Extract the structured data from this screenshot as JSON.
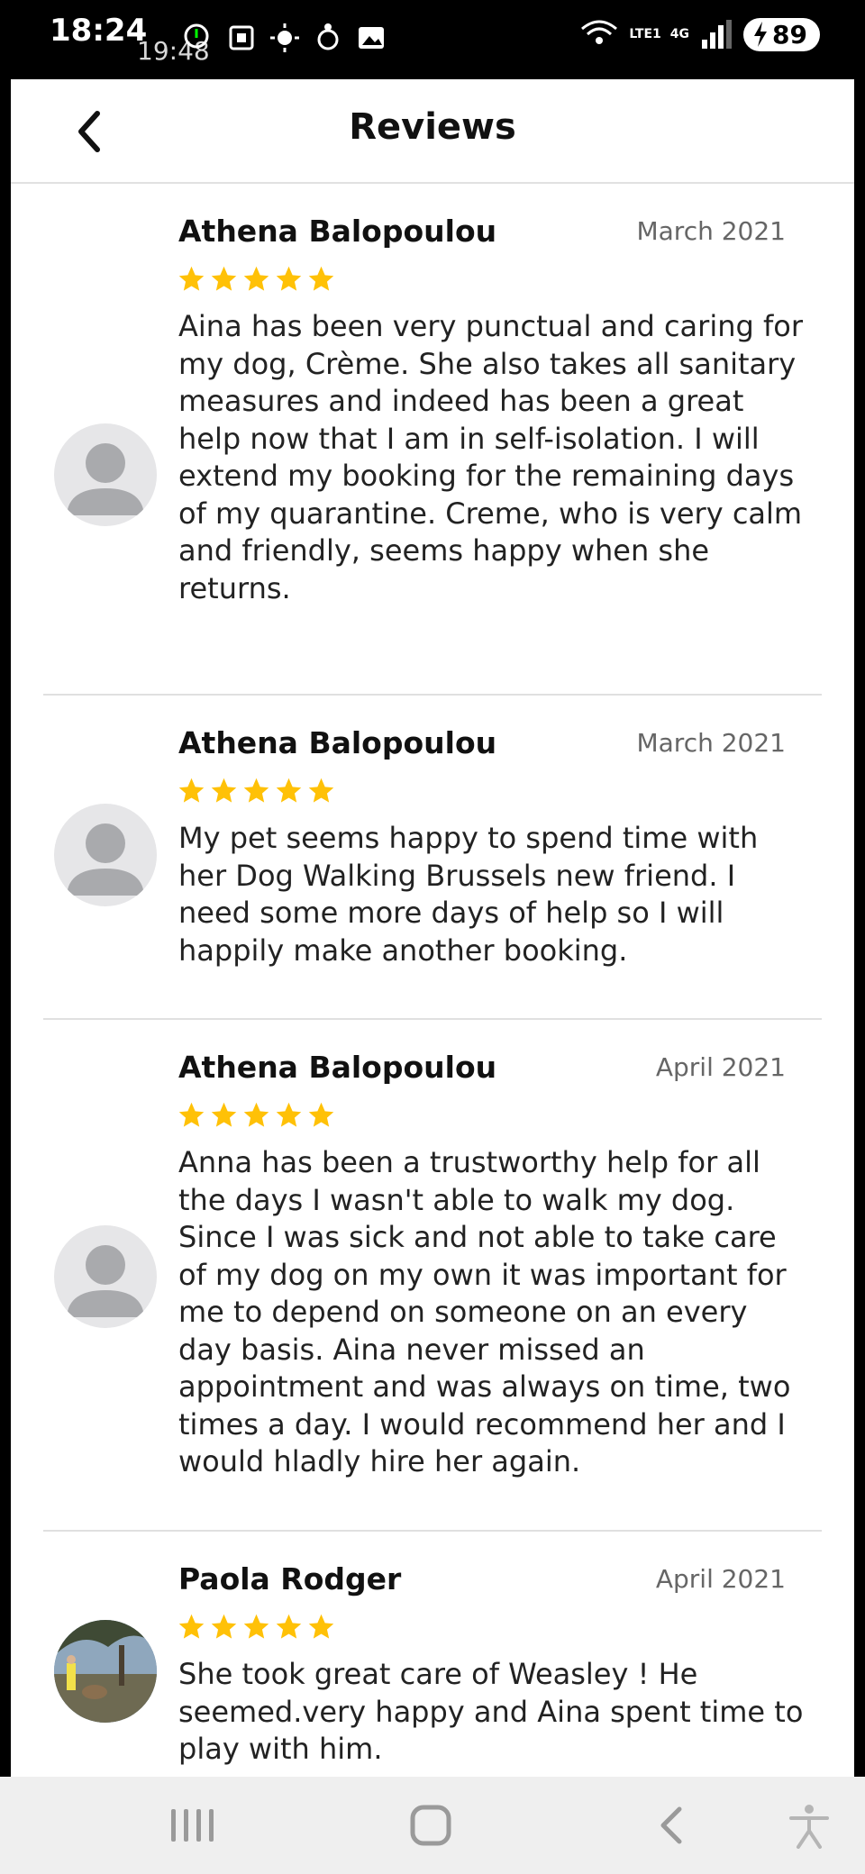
{
  "status_bar": {
    "time": "18:24",
    "overlap_time": "19:48",
    "network_label": "LTE1",
    "network_type": "4G",
    "battery": "89"
  },
  "header": {
    "title": "Reviews"
  },
  "reviews": [
    {
      "name": "Athena Balopoulou",
      "date": "March 2021",
      "rating": 5,
      "text": "Aina has been very punctual and caring for my dog, Crème. She also takes all sanitary measures and indeed has been a great help now that I am in self-isolation. I will extend my booking for the remaining days of my quarantine. Creme, who is very calm and friendly, seems happy when she returns."
    },
    {
      "name": "Athena Balopoulou",
      "date": "March 2021",
      "rating": 5,
      "text": "My pet seems happy to spend time with her Dog Walking Brussels new friend. I need some more days of help so I will happily make another booking."
    },
    {
      "name": "Athena Balopoulou",
      "date": "April 2021",
      "rating": 5,
      "text": "Anna has been a trustworthy help for all the days I wasn't able to walk my dog. Since I was sick and not able to take care of my dog on my own it was important for me to depend on someone on an every day basis. Aina never missed an appointment and was always on time, two times a day. I would recommend her and I would hladly hire her again."
    },
    {
      "name": "Paola Rodger",
      "date": "April 2021",
      "rating": 5,
      "text": "She took great care of Weasley ! He seemed.very happy and Aina spent time to play with him."
    }
  ],
  "colors": {
    "star": "#FFC107",
    "divider": "#e0e0e0",
    "avatar_bg": "#e6e6e8",
    "avatar_fg": "#a9aaad"
  },
  "nav": {
    "recents_icon": "recents-icon",
    "home_icon": "home-icon",
    "back_icon": "back-nav-icon",
    "accessibility_icon": "accessibility-icon"
  }
}
